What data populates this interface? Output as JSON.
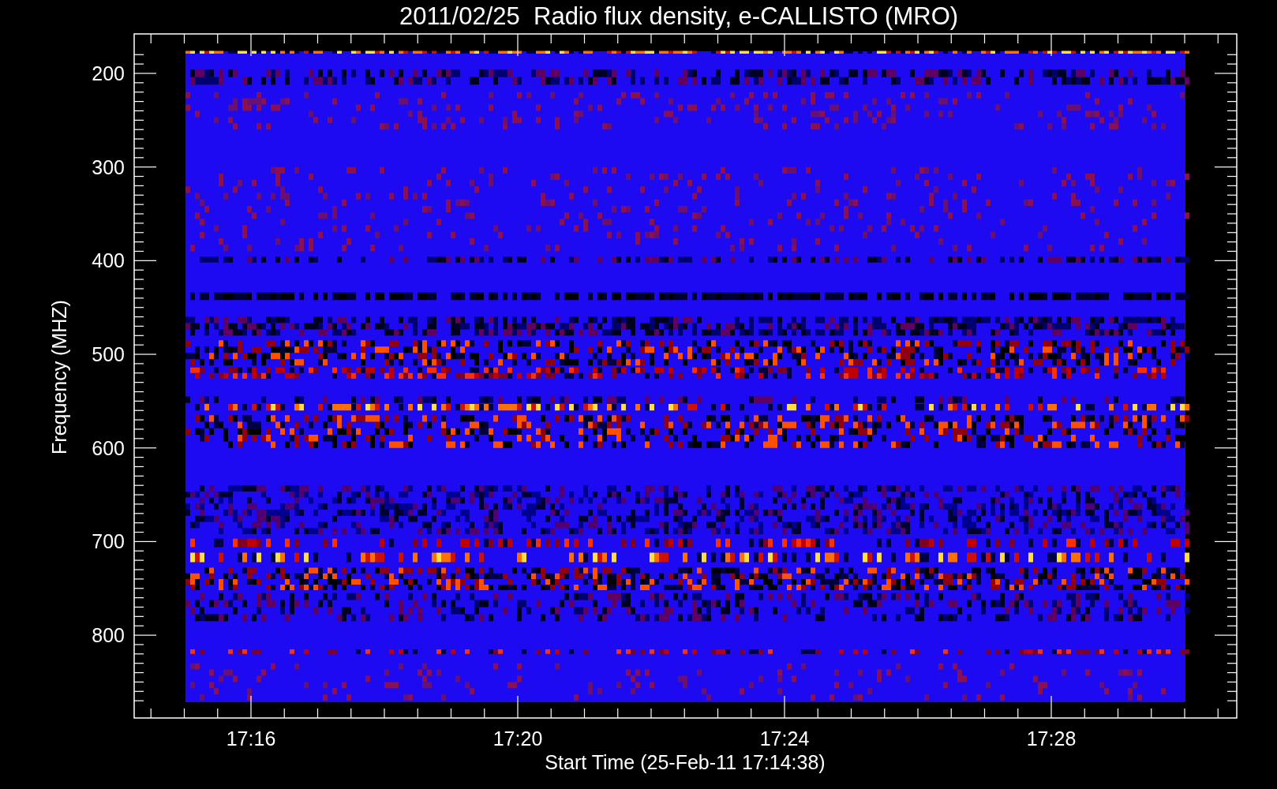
{
  "chart": {
    "title": "2011/02/25  Radio flux density, e-CALLISTO (MRO)",
    "ylabel": "Frequency (MHZ)",
    "xlabel": "Start Time (25-Feb-11 17:14:38)",
    "yticks": [
      "200",
      "300",
      "400",
      "500",
      "600",
      "700",
      "800"
    ],
    "xticks": [
      "17:16",
      "17:20",
      "17:24",
      "17:28"
    ]
  }
}
